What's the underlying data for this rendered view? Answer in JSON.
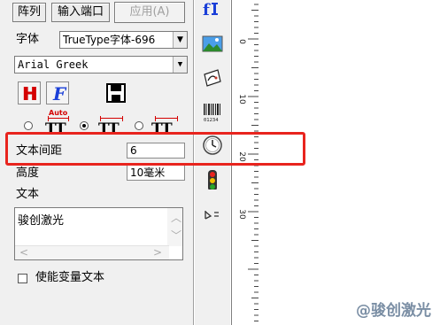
{
  "toolbar": {
    "array_label": "阵列",
    "input_port_label": "输入端口",
    "apply_label": "应用(A)"
  },
  "font": {
    "label": "字体",
    "type_value": "TrueType字体-696",
    "name_value": "Arial Greek"
  },
  "style_buttons": {
    "bold_glyph": "H",
    "italic_glyph": "F"
  },
  "spacing_modes": {
    "auto_label": "Auto",
    "glyph": "TT",
    "selected_index": 1
  },
  "char_spacing": {
    "label": "文本间距",
    "value": "6"
  },
  "height": {
    "label": "高度",
    "value": "10毫米"
  },
  "text": {
    "label": "文本",
    "content": "骏创激光"
  },
  "enable_variable": {
    "label": "使能变量文本",
    "checked": false
  },
  "ruler": {
    "labels": [
      "0",
      "10",
      "20",
      "30"
    ]
  },
  "barcode_caption": "01234",
  "watermark": "@骏创激光",
  "colors": {
    "highlight": "#e8241e",
    "accent_red": "#d40000",
    "accent_blue": "#1a3fd8"
  }
}
